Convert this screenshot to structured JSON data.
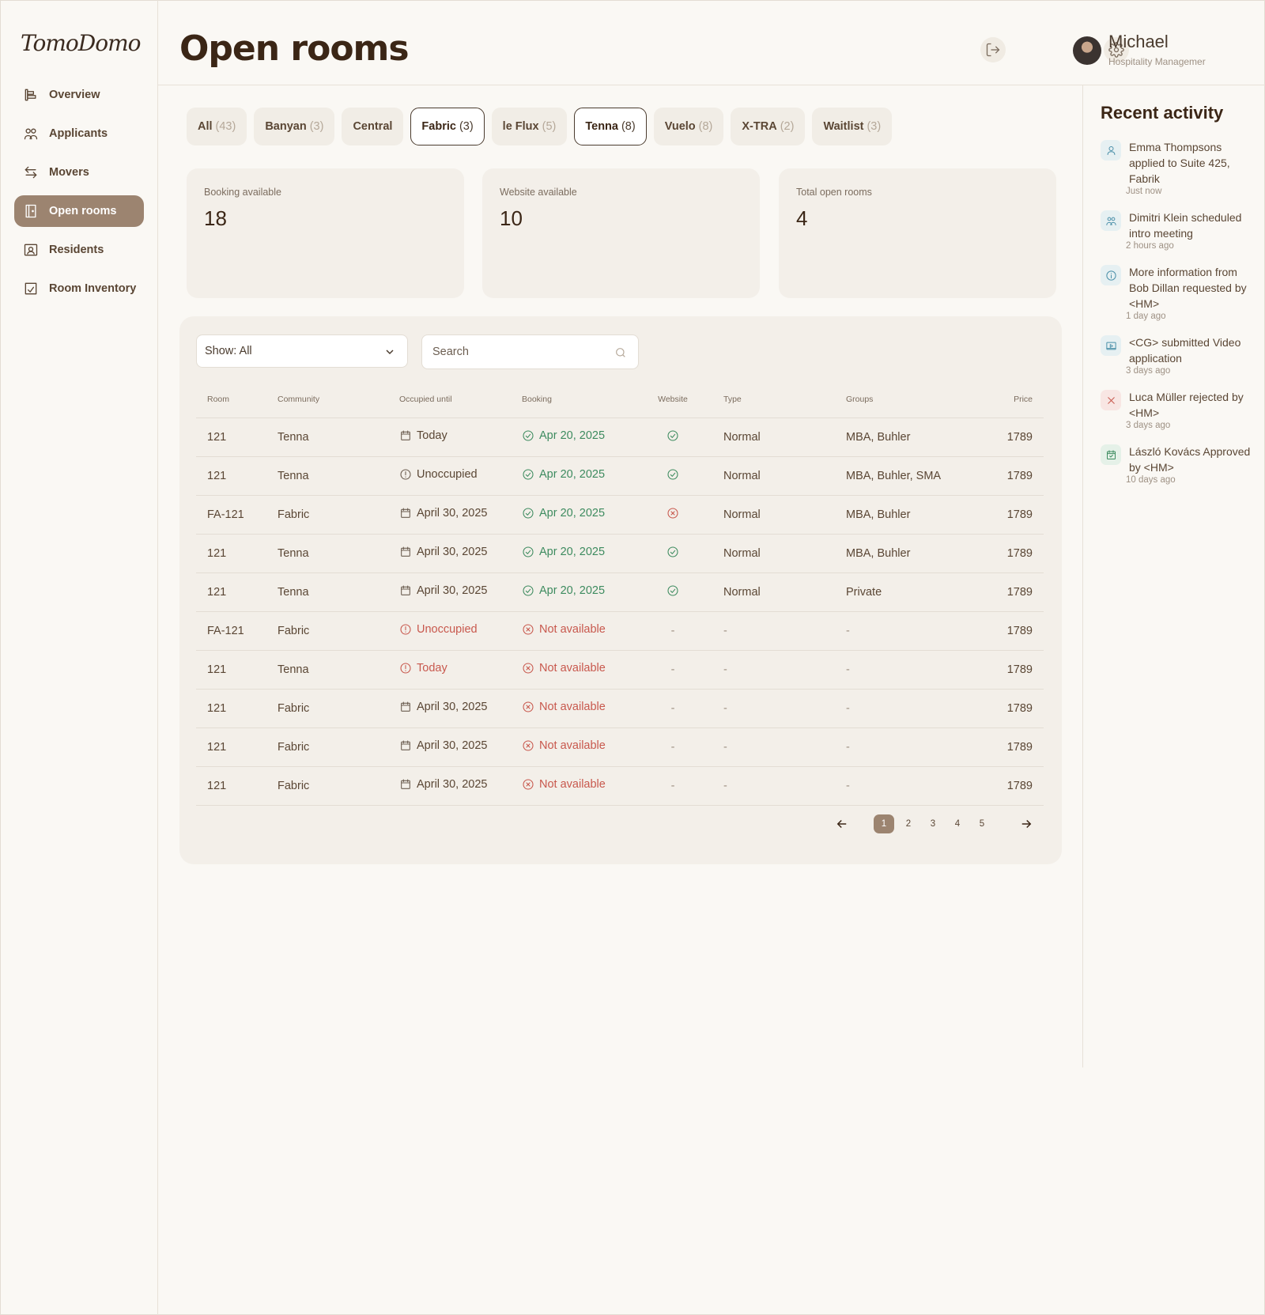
{
  "app": {
    "logo": "TomoDomo"
  },
  "sidebar": {
    "items": [
      {
        "label": "Overview",
        "icon": "overview-icon",
        "active": false
      },
      {
        "label": "Applicants",
        "icon": "users-icon",
        "active": false
      },
      {
        "label": "Movers",
        "icon": "swap-arrows-icon",
        "active": false
      },
      {
        "label": "Open rooms",
        "icon": "door-icon",
        "active": true
      },
      {
        "label": "Residents",
        "icon": "id-card-icon",
        "active": false
      },
      {
        "label": "Room Inventory",
        "icon": "inventory-icon",
        "active": false
      }
    ]
  },
  "header": {
    "title": "Open rooms",
    "user_name": "Michael",
    "user_role": "Hospitality Managemer"
  },
  "tabs": [
    {
      "label": "All",
      "count": "(43)",
      "selected": false
    },
    {
      "label": "Banyan",
      "count": "(3)",
      "selected": false
    },
    {
      "label": "Central",
      "count": "",
      "selected": false
    },
    {
      "label": "Fabric",
      "count": "(3)",
      "selected": true
    },
    {
      "label": "le Flux",
      "count": "(5)",
      "selected": false
    },
    {
      "label": "Tenna",
      "count": "(8)",
      "selected": true
    },
    {
      "label": "Vuelo",
      "count": "(8)",
      "selected": false
    },
    {
      "label": "X-TRA",
      "count": "(2)",
      "selected": false
    },
    {
      "label": "Waitlist",
      "count": "(3)",
      "selected": false
    }
  ],
  "stats": [
    {
      "label": "Booking available",
      "value": "18"
    },
    {
      "label": "Website available",
      "value": "10"
    },
    {
      "label": "Total open rooms",
      "value": "4"
    }
  ],
  "filters": {
    "show_value": "Show: All",
    "search_placeholder": "Search"
  },
  "table": {
    "columns": [
      "Room",
      "Community",
      "Occupied until",
      "Booking",
      "Website",
      "Type",
      "Groups",
      "Price"
    ],
    "rows": [
      {
        "room": "121",
        "community": "Tenna",
        "occupied": "Today",
        "occ_icon": "calendar-icon",
        "occ_status": "normal",
        "booking": "Apr 20, 2025",
        "booking_ok": true,
        "website": "ok",
        "type": "Normal",
        "groups": "MBA, Buhler",
        "price": "1789"
      },
      {
        "room": "121",
        "community": "Tenna",
        "occupied": "Unoccupied",
        "occ_icon": "alert-circle-icon",
        "occ_status": "normal",
        "booking": "Apr 20, 2025",
        "booking_ok": true,
        "website": "ok",
        "type": "Normal",
        "groups": "MBA, Buhler, SMA",
        "price": "1789"
      },
      {
        "room": "FA-121",
        "community": "Fabric",
        "occupied": "April 30, 2025",
        "occ_icon": "calendar-icon",
        "occ_status": "normal",
        "booking": "Apr 20, 2025",
        "booking_ok": true,
        "website": "no",
        "type": "Normal",
        "groups": "MBA, Buhler",
        "price": "1789"
      },
      {
        "room": "121",
        "community": "Tenna",
        "occupied": "April 30, 2025",
        "occ_icon": "calendar-icon",
        "occ_status": "normal",
        "booking": "Apr 20, 2025",
        "booking_ok": true,
        "website": "ok",
        "type": "Normal",
        "groups": "MBA, Buhler",
        "price": "1789"
      },
      {
        "room": "121",
        "community": "Tenna",
        "occupied": "April 30, 2025",
        "occ_icon": "calendar-icon",
        "occ_status": "normal",
        "booking": "Apr 20, 2025",
        "booking_ok": true,
        "website": "ok",
        "type": "Normal",
        "groups": "Private",
        "price": "1789"
      },
      {
        "room": "FA-121",
        "community": "Fabric",
        "occupied": "Unoccupied",
        "occ_icon": "alert-circle-icon",
        "occ_status": "alert",
        "booking": "Not available",
        "booking_ok": false,
        "website": "-",
        "type": "-",
        "groups": "-",
        "price": "1789"
      },
      {
        "room": "121",
        "community": "Tenna",
        "occupied": "Today",
        "occ_icon": "alert-circle-icon",
        "occ_status": "alert",
        "booking": "Not available",
        "booking_ok": false,
        "website": "-",
        "type": "-",
        "groups": "-",
        "price": "1789"
      },
      {
        "room": "121",
        "community": "Fabric",
        "occupied": "April 30, 2025",
        "occ_icon": "calendar-icon",
        "occ_status": "normal",
        "booking": "Not available",
        "booking_ok": false,
        "website": "-",
        "type": "-",
        "groups": "-",
        "price": "1789"
      },
      {
        "room": "121",
        "community": "Fabric",
        "occupied": "April 30, 2025",
        "occ_icon": "calendar-icon",
        "occ_status": "normal",
        "booking": "Not available",
        "booking_ok": false,
        "website": "-",
        "type": "-",
        "groups": "-",
        "price": "1789"
      },
      {
        "room": "121",
        "community": "Fabric",
        "occupied": "April 30, 2025",
        "occ_icon": "calendar-icon",
        "occ_status": "normal",
        "booking": "Not available",
        "booking_ok": false,
        "website": "-",
        "type": "-",
        "groups": "-",
        "price": "1789"
      }
    ]
  },
  "pagination": {
    "pages": [
      "1",
      "2",
      "3",
      "4",
      "5"
    ],
    "current": "1"
  },
  "activity": {
    "title": "Recent activity",
    "items": [
      {
        "icon": "user-icon",
        "kind": "info",
        "text": "Emma Thompsons applied to Suite 425, Fabrik",
        "time": "Just now"
      },
      {
        "icon": "users-icon",
        "kind": "info",
        "text": "Dimitri Klein scheduled intro meeting",
        "time": "2 hours ago"
      },
      {
        "icon": "info-icon",
        "kind": "info",
        "text": "More information from Bob Dillan requested by <HM>",
        "time": "1 day ago"
      },
      {
        "icon": "video-icon",
        "kind": "info",
        "text": "<CG> submitted Video application",
        "time": "3 days ago"
      },
      {
        "icon": "close-icon",
        "kind": "danger",
        "text": "Luca Müller rejected by <HM>",
        "time": "3 days ago"
      },
      {
        "icon": "calendar-check-icon",
        "kind": "success",
        "text": "László Kovács Approved by <HM>",
        "time": "10 days ago"
      }
    ]
  },
  "colors": {
    "accent": "#9c8470",
    "success": "#3d8b5f",
    "danger": "#c8584d",
    "info": "#4a8fa8",
    "background": "#faf8f4",
    "card": "#f3efe9"
  }
}
